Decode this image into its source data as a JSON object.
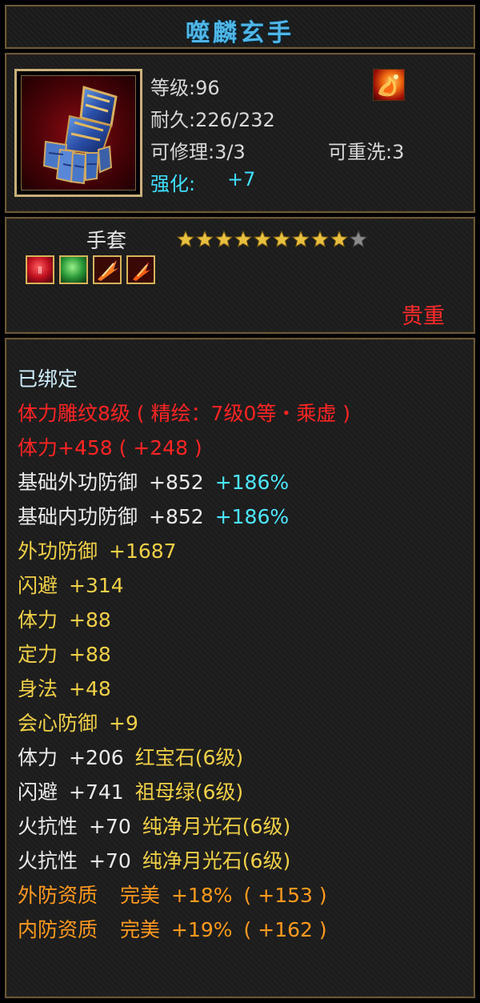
{
  "item": {
    "name": "噬麟玄手",
    "level": "等级:96",
    "durability": "耐久:226/232",
    "repair": "可修理:3/3",
    "rewash": "可重洗:3",
    "enhance_label": "强化:",
    "enhance_value": "+7",
    "type": "手套",
    "stars_filled": 9,
    "stars_total": 10,
    "rarity": "贵重"
  },
  "icons": {
    "item_portrait": "gauntlet-icon",
    "set_badge": "flame-swirl-icon",
    "slots": [
      "red-gem-slot-icon",
      "green-gem-slot-icon",
      "flame-slot-icon",
      "flame-slot-icon"
    ]
  },
  "colors": {
    "title": "#4fb6e8",
    "bound": "#cfeffc",
    "engrave": "#ff2424",
    "base": "#eaeaea",
    "bonus": "#4de8ff",
    "extra": "#f0d048",
    "quality": "#ff9a1e",
    "rarity": "#ff2a2a"
  },
  "attributes": {
    "bound": "已绑定",
    "engrave": "体力雕纹8级 ( 精绘：7级0等・乘虚 )",
    "engrave_stat": "体力+458 ( +248 )",
    "base": [
      {
        "label": "基础外功防御",
        "value": "+852",
        "bonus": "+186%"
      },
      {
        "label": "基础内功防御",
        "value": "+852",
        "bonus": "+186%"
      }
    ],
    "extra": [
      {
        "label": "外功防御",
        "value": "+1687"
      },
      {
        "label": "闪避",
        "value": "+314"
      },
      {
        "label": "体力",
        "value": "+88"
      },
      {
        "label": "定力",
        "value": "+88"
      },
      {
        "label": "身法",
        "value": "+48"
      },
      {
        "label": "会心防御",
        "value": "+9"
      }
    ],
    "gems": [
      {
        "label": "体力",
        "value": "+206",
        "gem": "红宝石(6级)"
      },
      {
        "label": "闪避",
        "value": "+741",
        "gem": "祖母绿(6级)"
      },
      {
        "label": "火抗性",
        "value": "+70",
        "gem": "纯净月光石(6级)"
      },
      {
        "label": "火抗性",
        "value": "+70",
        "gem": "纯净月光石(6级)"
      }
    ],
    "quality": [
      {
        "label": "外防资质",
        "grade": "完美",
        "value": "+18%",
        "extra": "( +153 )"
      },
      {
        "label": "内防资质",
        "grade": "完美",
        "value": "+19%",
        "extra": "( +162 )"
      }
    ]
  }
}
